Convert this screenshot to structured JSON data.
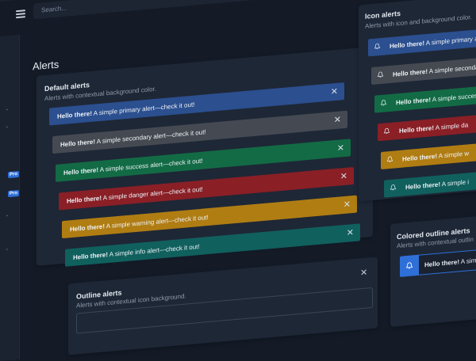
{
  "search": {
    "placeholder": "Search..."
  },
  "sidebar": {
    "badges": [
      "Pro",
      "Pro"
    ]
  },
  "page": {
    "title": "Alerts"
  },
  "default_alerts": {
    "title": "Default alerts",
    "subtitle": "Alerts with contextual background color.",
    "items": [
      {
        "strong": "Hello there!",
        "text": " A simple primary alert—check it out!",
        "color": "#2b4f8f"
      },
      {
        "strong": "Hello there!",
        "text": " A simple secondary alert—check it out!",
        "color": "#454a52"
      },
      {
        "strong": "Hello there!",
        "text": " A simple success alert—check it out!",
        "color": "#126b45"
      },
      {
        "strong": "Hello there!",
        "text": " A simple danger alert—check it out!",
        "color": "#8a1f26"
      },
      {
        "strong": "Hello there!",
        "text": " A simple warning alert—check it out!",
        "color": "#b07d13"
      },
      {
        "strong": "Hello there!",
        "text": " A simple info alert—check it out!",
        "color": "#10605e"
      }
    ]
  },
  "icon_alerts": {
    "title": "Icon alerts",
    "subtitle": "Alerts with icon and background color.",
    "items": [
      {
        "strong": "Hello there!",
        "text": " A simple primary alert",
        "color": "#2b4f8f"
      },
      {
        "strong": "Hello there!",
        "text": " A simple secondary",
        "color": "#454a52"
      },
      {
        "strong": "Hello there!",
        "text": " A simple success",
        "color": "#126b45"
      },
      {
        "strong": "Hello there!",
        "text": " A simple da",
        "color": "#8a1f26"
      },
      {
        "strong": "Hello there!",
        "text": " A simple w",
        "color": "#b07d13"
      },
      {
        "strong": "Hello there!",
        "text": " A simple i",
        "color": "#10605e"
      }
    ]
  },
  "outline_alerts": {
    "title": "Outline alerts",
    "subtitle": "Alerts with contextual icon background."
  },
  "colored_outline_alerts": {
    "title": "Colored outline alerts",
    "subtitle": "Alerts with contextual outlin",
    "first": {
      "strong": "Hello there!",
      "text": " A simple p"
    }
  },
  "icons": {
    "close": "✕",
    "menu": "menu-icon",
    "bell": "bell-icon"
  }
}
